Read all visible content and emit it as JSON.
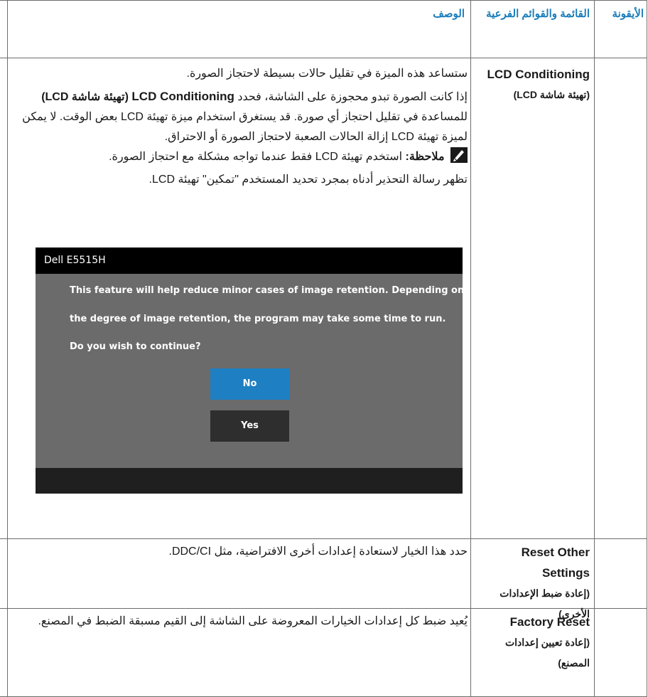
{
  "table": {
    "headers": {
      "icon": "الأيقونة",
      "menu": "القائمة والقوائم الفرعية",
      "description": "الوصف"
    },
    "rows": [
      {
        "menu_en": "LCD Conditioning",
        "menu_ar": "(تهيئة شاشة LCD)",
        "p1": "ستساعد هذه الميزة في تقليل حالات بسيطة لاحتجاز الصورة.",
        "p2_pre": "إذا كانت الصورة تبدو محجوزة على الشاشة، فحدد",
        "p2_bold_en": "LCD Conditioning",
        "p2_bold_ar": "(تهيئة شاشة LCD)",
        "p2_post": "للمساعدة في تقليل احتجاز أي صورة. قد يستغرق استخدام ميزة تهيئة LCD بعض الوقت. لا يمكن لميزة تهيئة LCD إزالة الحالات الصعبة لاحتجاز الصورة أو الاحتراق.",
        "note_label": "ملاحظة:",
        "note_text": "استخدم تهيئة LCD فقط عندما تواجه مشكلة مع احتجاز الصورة.",
        "p4": "تظهر رسالة التحذير أدناه بمجرد تحديد المستخدم \"تمكين\" تهيئة LCD."
      },
      {
        "menu_en": "Reset Other Settings",
        "menu_ar": "(إعادة ضبط الإعدادات الأخرى)",
        "desc": "حدد هذا الخيار لاستعادة إعدادات أخرى الافتراضية، مثل DDC/CI."
      },
      {
        "menu_en": "Factory Reset",
        "menu_ar": "(إعادة تعيين إعدادات المصنع)",
        "desc": "يُعيد ضبط كل إعدادات الخيارات المعروضة على الشاشة إلى القيم مسبقة الضبط في المصنع."
      }
    ]
  },
  "dialog": {
    "title": "Dell E5515H",
    "line1": "This feature will help reduce minor cases of image retention. Depending on",
    "line2": "the degree of image retention, the program may take some time to run.",
    "line3": "Do you wish to continue?",
    "no_label": "No",
    "yes_label": "Yes",
    "colors": {
      "title_bar": "#000000",
      "body": "#6b6b6b",
      "footer": "#1f1f1f",
      "no_button": "#1e7fc3",
      "yes_button": "#2e2e2e"
    }
  },
  "icons": {
    "note": "pencil-note-icon"
  }
}
